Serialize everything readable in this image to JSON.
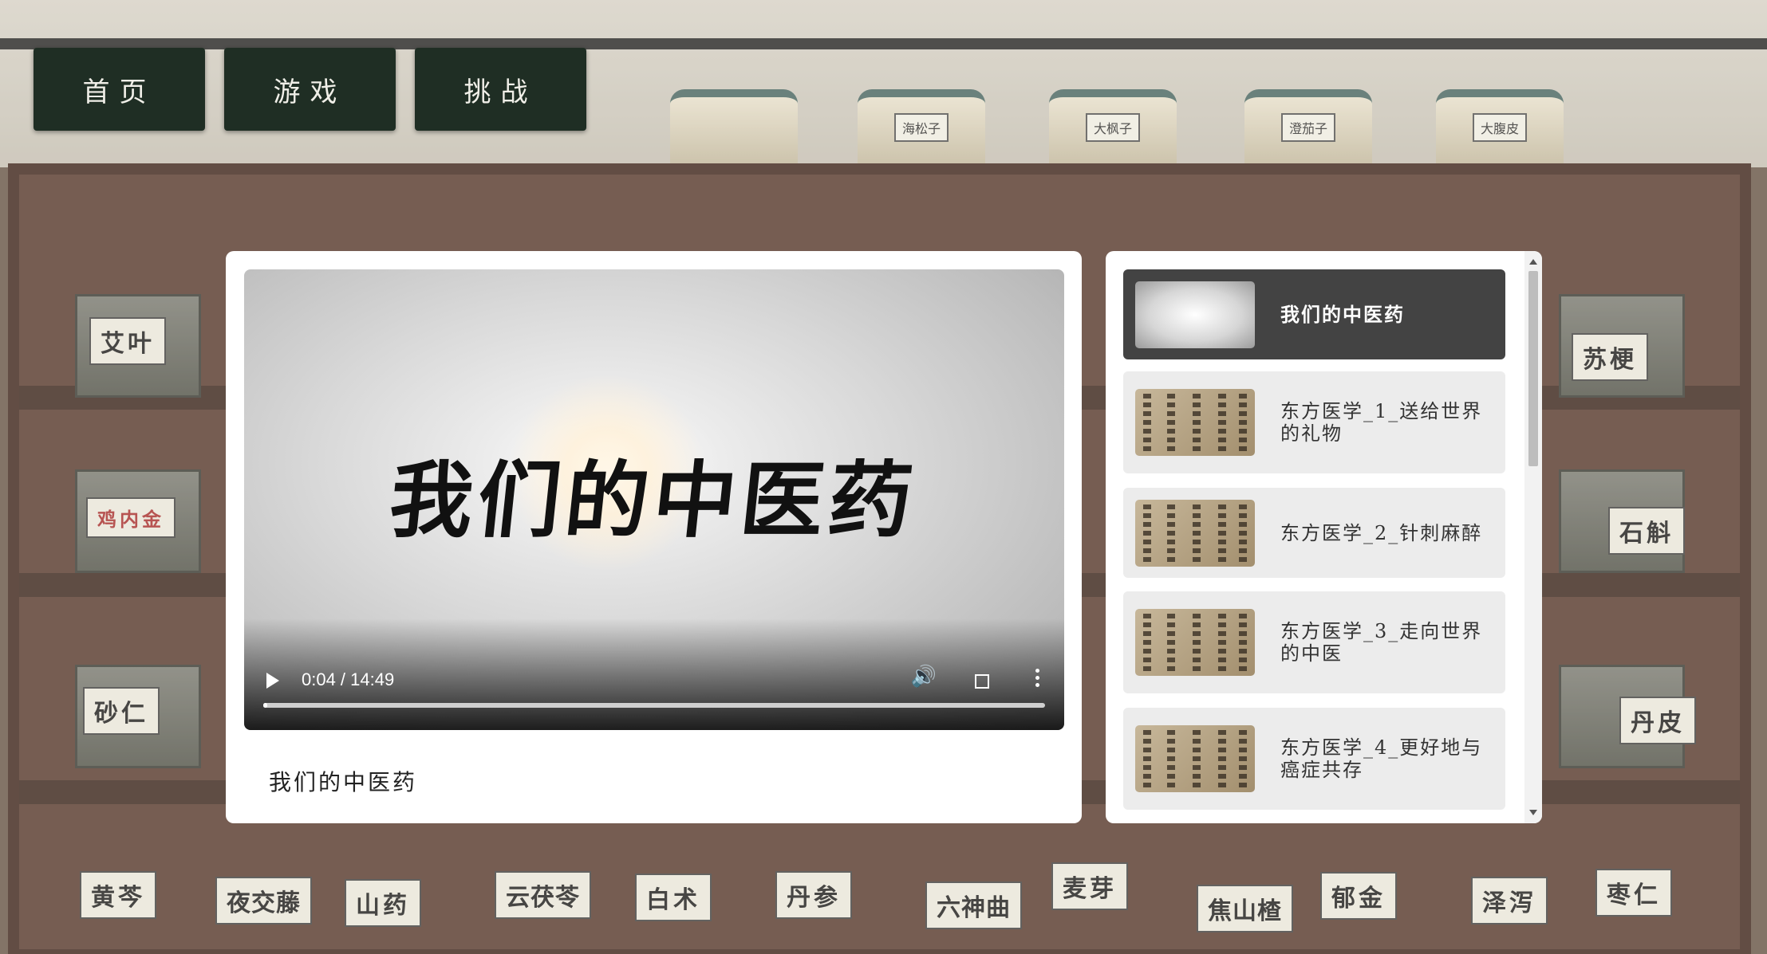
{
  "nav": {
    "items": [
      "首页",
      "游戏",
      "挑战"
    ]
  },
  "background_labels": {
    "pots": [
      "海松子",
      "大枫子",
      "澄茄子",
      "大腹皮"
    ],
    "drawers": [
      "艾叶",
      "鸡内金",
      "砂仁",
      "苏梗",
      "石斛",
      "丹皮",
      "黄芩",
      "夜交藤",
      "山药",
      "云茯苓",
      "白术",
      "丹参",
      "六神曲",
      "麦芽",
      "焦山楂",
      "郁金",
      "泽泻",
      "枣仁"
    ]
  },
  "player": {
    "video_title_art": "我们的中医药",
    "time": "0:04 / 14:49",
    "progress": 0.005,
    "caption": "我们的中医药"
  },
  "playlist": {
    "items": [
      {
        "label": "我们的中医药",
        "active": true
      },
      {
        "label": "东方医学_1_送给世界的礼物",
        "active": false
      },
      {
        "label": "东方医学_2_针刺麻醉",
        "active": false
      },
      {
        "label": "东方医学_3_走向世界的中医",
        "active": false
      },
      {
        "label": "东方医学_4_更好地与癌症共存",
        "active": false
      }
    ]
  },
  "icons": {
    "play": "play-icon",
    "volume": "volume-icon",
    "fullscreen": "fullscreen-icon",
    "more": "more-vert-icon"
  }
}
